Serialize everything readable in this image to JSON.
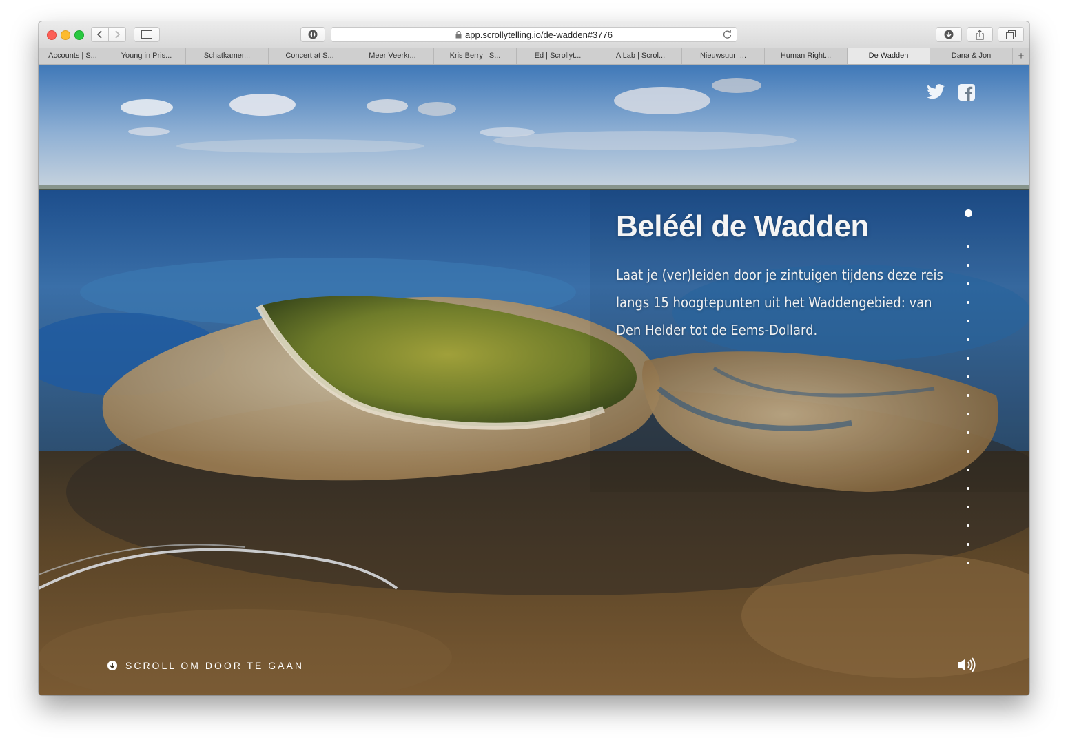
{
  "browser": {
    "url": "app.scrollytelling.io/de-wadden#3776",
    "tabs": [
      {
        "label": "Accounts | S...",
        "width": 100
      },
      {
        "label": "Young in Pris...",
        "width": 114
      },
      {
        "label": "Schatkamer...",
        "width": 120
      },
      {
        "label": "Concert at S...",
        "width": 120
      },
      {
        "label": "Meer Veerkr...",
        "width": 120
      },
      {
        "label": "Kris Berry | S...",
        "width": 120
      },
      {
        "label": "Ed | Scrollyt...",
        "width": 120
      },
      {
        "label": "A Lab | Scrol...",
        "width": 120
      },
      {
        "label": "Nieuwsuur |...",
        "width": 120
      },
      {
        "label": "Human Right...",
        "width": 120
      },
      {
        "label": "De Wadden",
        "width": 120,
        "active": true
      },
      {
        "label": "Dana & Jon",
        "width": 120
      }
    ],
    "new_tab_label": "+"
  },
  "page": {
    "headline": "Beléél de Wadden",
    "intro": "Laat je (ver)leiden door je zintuigen tijdens deze reis langs 15 hoogtepunten uit het Waddengebied: van Den Helder tot de Eems-Dollard.",
    "scroll_hint": "SCROLL OM DOOR TE GAAN",
    "nav_dots": {
      "count": 19,
      "active_index": 0
    },
    "social": [
      "twitter-icon",
      "facebook-icon"
    ]
  },
  "colors": {
    "sky": "#8fb4d8",
    "sea": "#2c5f9a",
    "sand": "#b89a6e",
    "island": "#7e8a2e",
    "mudflat": "#5a4326",
    "text": "#f4f4f4"
  }
}
